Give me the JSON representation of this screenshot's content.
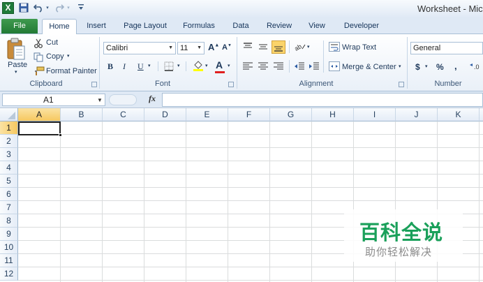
{
  "window": {
    "app_icon": "X",
    "title": "Worksheet - Mic",
    "qat": [
      {
        "icon": "save-icon",
        "glyph": "▣"
      },
      {
        "icon": "undo-icon",
        "glyph": "↶"
      },
      {
        "icon": "redo-icon",
        "glyph": "↷"
      },
      {
        "icon": "customize-qat-icon",
        "glyph": "▾"
      }
    ]
  },
  "tabs": [
    "File",
    "Home",
    "Insert",
    "Page Layout",
    "Formulas",
    "Data",
    "Review",
    "View",
    "Developer"
  ],
  "active_tab": "Home",
  "ribbon": {
    "clipboard": {
      "label": "Clipboard",
      "paste": "Paste",
      "cut": "Cut",
      "copy": "Copy",
      "format_painter": "Format Painter"
    },
    "font": {
      "label": "Font",
      "font_name": "Calibri",
      "font_size": "11",
      "grow": "A",
      "shrink": "A",
      "bold": "B",
      "italic": "I",
      "underline": "U",
      "font_color_letter": "A"
    },
    "alignment": {
      "label": "Alignment",
      "wrap_text": "Wrap Text",
      "merge_center": "Merge & Center"
    },
    "number": {
      "label": "Number",
      "format": "General",
      "currency": "$",
      "percent": "%",
      "comma": ","
    }
  },
  "formula_bar": {
    "name_box": "A1",
    "fx": "fx",
    "value": ""
  },
  "grid": {
    "columns": [
      "A",
      "B",
      "C",
      "D",
      "E",
      "F",
      "G",
      "H",
      "I",
      "J",
      "K"
    ],
    "rows": [
      "1",
      "2",
      "3",
      "4",
      "5",
      "6",
      "7",
      "8",
      "9",
      "10",
      "11",
      "12"
    ],
    "active_cell": "A1"
  },
  "watermark": {
    "title": "百科全说",
    "subtitle": "助你轻松解决"
  },
  "colors": {
    "file_tab": "#227a35",
    "selection_header": "#f6c860",
    "watermark_green": "#1aa05a"
  }
}
